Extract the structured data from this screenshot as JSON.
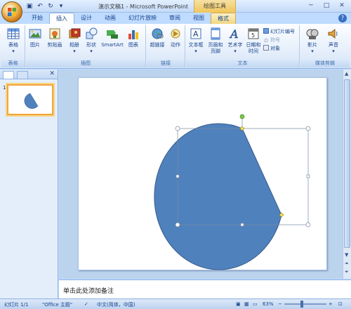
{
  "window": {
    "title": "演示文稿1 - Microsoft PowerPoint",
    "contextual_tools": "绘图工具"
  },
  "tabs": [
    "开始",
    "插入",
    "设计",
    "动画",
    "幻灯片放映",
    "审阅",
    "视图",
    "格式"
  ],
  "active_tab": "插入",
  "ribbon": {
    "groups": {
      "tables": "表格",
      "illustrations": "插图",
      "links": "链接",
      "text": "文本",
      "media": "媒体剪辑"
    },
    "buttons": {
      "table": "表格",
      "picture": "图片",
      "clipart": "剪贴画",
      "album": "相册",
      "shapes": "形状",
      "smartart": "SmartArt",
      "chart": "图表",
      "hyperlink": "超链接",
      "action": "动作",
      "textbox": "文本框",
      "header_footer_1": "页眉和",
      "header_footer_2": "页脚",
      "wordart": "艺术字",
      "datetime_1": "日期和",
      "datetime_2": "时间",
      "slide_number": "幻灯片编号",
      "symbol": "符号",
      "object": "对象",
      "movie": "影片",
      "sound": "声音"
    }
  },
  "slides_pane": {
    "slide_number": "1"
  },
  "notes": {
    "placeholder": "单击此处添加备注"
  },
  "status": {
    "slide": "幻灯片 1/1",
    "theme": "\"Office 主题\"",
    "language": "中文(简体，中国)",
    "zoom": "63%"
  },
  "colors": {
    "shape_fill": "#4f81bd",
    "shape_outline": "#385d8a"
  }
}
